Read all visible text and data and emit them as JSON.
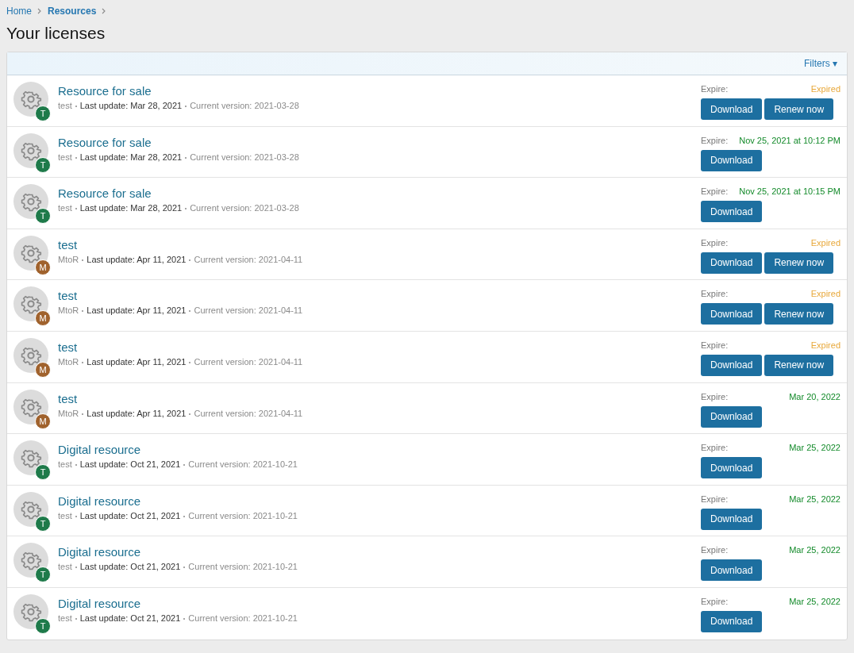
{
  "breadcrumbs": [
    "Home",
    "Resources"
  ],
  "title": "Your licenses",
  "filters": {
    "label": "Filters",
    "caret": "▾"
  },
  "licenses": [
    {
      "title": "Resource for sale",
      "badge": "T",
      "color": "#1e7a4a",
      "author": "test",
      "last_update": "Last update: Mar 28, 2021",
      "version": "Current version: 2021-03-28",
      "expire_label": "Expire:",
      "expire": "Expired",
      "expired": true,
      "buttons": [
        "Download",
        "Renew now"
      ]
    },
    {
      "title": "Resource for sale",
      "badge": "T",
      "color": "#1e7a4a",
      "author": "test",
      "last_update": "Last update: Mar 28, 2021",
      "version": "Current version: 2021-03-28",
      "expire_label": "Expire:",
      "expire": "Nov 25, 2021 at 10:12 PM",
      "expired": false,
      "buttons": [
        "Download"
      ]
    },
    {
      "title": "Resource for sale",
      "badge": "T",
      "color": "#1e7a4a",
      "author": "test",
      "last_update": "Last update: Mar 28, 2021",
      "version": "Current version: 2021-03-28",
      "expire_label": "Expire:",
      "expire": "Nov 25, 2021 at 10:15 PM",
      "expired": false,
      "buttons": [
        "Download"
      ]
    },
    {
      "title": "test",
      "badge": "M",
      "color": "#a0622d",
      "author": "MtoR",
      "last_update": "Last update: Apr 11, 2021",
      "version": "Current version: 2021-04-11",
      "expire_label": "Expire:",
      "expire": "Expired",
      "expired": true,
      "buttons": [
        "Download",
        "Renew now"
      ]
    },
    {
      "title": "test",
      "badge": "M",
      "color": "#a0622d",
      "author": "MtoR",
      "last_update": "Last update: Apr 11, 2021",
      "version": "Current version: 2021-04-11",
      "expire_label": "Expire:",
      "expire": "Expired",
      "expired": true,
      "buttons": [
        "Download",
        "Renew now"
      ]
    },
    {
      "title": "test",
      "badge": "M",
      "color": "#a0622d",
      "author": "MtoR",
      "last_update": "Last update: Apr 11, 2021",
      "version": "Current version: 2021-04-11",
      "expire_label": "Expire:",
      "expire": "Expired",
      "expired": true,
      "buttons": [
        "Download",
        "Renew now"
      ]
    },
    {
      "title": "test",
      "badge": "M",
      "color": "#a0622d",
      "author": "MtoR",
      "last_update": "Last update: Apr 11, 2021",
      "version": "Current version: 2021-04-11",
      "expire_label": "Expire:",
      "expire": "Mar 20, 2022",
      "expired": false,
      "buttons": [
        "Download"
      ]
    },
    {
      "title": "Digital resource",
      "badge": "T",
      "color": "#1e7a4a",
      "author": "test",
      "last_update": "Last update: Oct 21, 2021",
      "version": "Current version: 2021-10-21",
      "expire_label": "Expire:",
      "expire": "Mar 25, 2022",
      "expired": false,
      "buttons": [
        "Download"
      ]
    },
    {
      "title": "Digital resource",
      "badge": "T",
      "color": "#1e7a4a",
      "author": "test",
      "last_update": "Last update: Oct 21, 2021",
      "version": "Current version: 2021-10-21",
      "expire_label": "Expire:",
      "expire": "Mar 25, 2022",
      "expired": false,
      "buttons": [
        "Download"
      ]
    },
    {
      "title": "Digital resource",
      "badge": "T",
      "color": "#1e7a4a",
      "author": "test",
      "last_update": "Last update: Oct 21, 2021",
      "version": "Current version: 2021-10-21",
      "expire_label": "Expire:",
      "expire": "Mar 25, 2022",
      "expired": false,
      "buttons": [
        "Download"
      ]
    },
    {
      "title": "Digital resource",
      "badge": "T",
      "color": "#1e7a4a",
      "author": "test",
      "last_update": "Last update: Oct 21, 2021",
      "version": "Current version: 2021-10-21",
      "expire_label": "Expire:",
      "expire": "Mar 25, 2022",
      "expired": false,
      "buttons": [
        "Download"
      ]
    }
  ]
}
